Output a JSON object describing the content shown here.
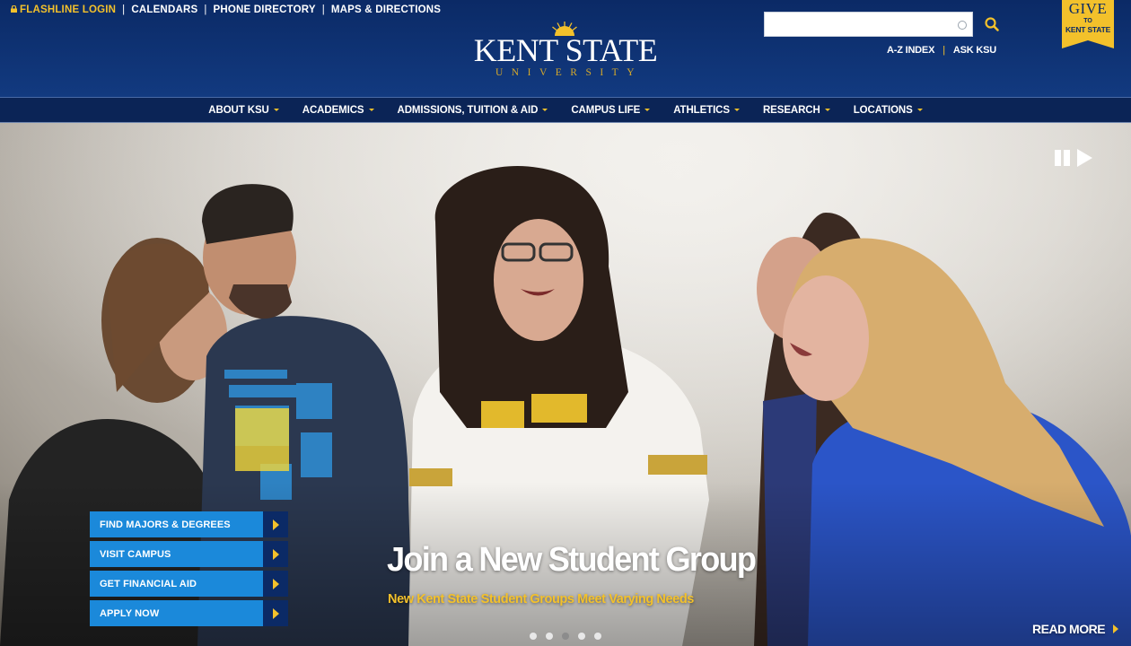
{
  "utility_links": {
    "flashline": "FLASHLINE LOGIN",
    "calendars": "CALENDARS",
    "phone_directory": "PHONE DIRECTORY",
    "maps": "MAPS & DIRECTIONS",
    "separator": "|"
  },
  "logo": {
    "name": "KENT STATE",
    "sub": "UNIVERSITY"
  },
  "search": {
    "value": "",
    "placeholder": ""
  },
  "right_links": {
    "az_index": "A-Z INDEX",
    "ask_ksu": "ASK KSU",
    "separator": "|"
  },
  "give_badge": {
    "line1": "GIVE",
    "line2": "TO",
    "line3": "KENT STATE"
  },
  "nav": {
    "items": [
      {
        "label": "ABOUT KSU"
      },
      {
        "label": "ACADEMICS"
      },
      {
        "label": "ADMISSIONS, TUITION & AID"
      },
      {
        "label": "CAMPUS LIFE"
      },
      {
        "label": "ATHLETICS"
      },
      {
        "label": "RESEARCH"
      },
      {
        "label": "LOCATIONS"
      }
    ]
  },
  "quick_links": [
    {
      "label": "FIND MAJORS & DEGREES"
    },
    {
      "label": "VISIT CAMPUS"
    },
    {
      "label": "GET FINANCIAL AID"
    },
    {
      "label": "APPLY NOW"
    }
  ],
  "hero": {
    "headline": "Join a New Student Group",
    "subhead": "New Kent State Student Groups Meet Varying Needs",
    "read_more": "READ MORE",
    "slide_count": 5,
    "active_slide": 3
  },
  "colors": {
    "navy": "#0b2a66",
    "gold": "#f3c12b",
    "button_blue": "#1b89da"
  },
  "icons": [
    "lock-icon",
    "search-icon",
    "pause-icon",
    "play-icon",
    "chevron-right-icon",
    "caret-down-icon"
  ]
}
